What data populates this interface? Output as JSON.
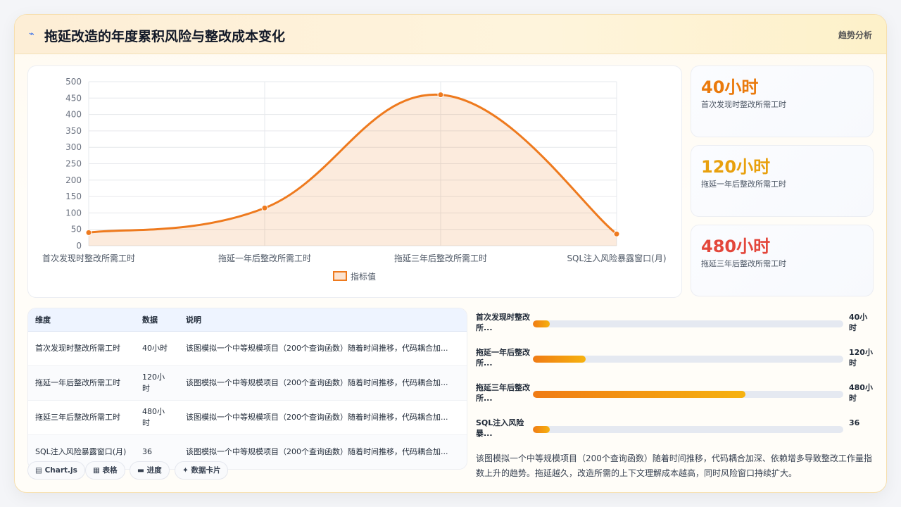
{
  "header": {
    "title": "拖延改造的年度累积风险与整改成本变化",
    "tag": "趋势分析"
  },
  "chart_data": {
    "type": "line",
    "categories": [
      "首次发现时整改所需工时",
      "拖延一年后整改所需工时",
      "拖延三年后整改所需工时",
      "SQL注入风险暴露窗口(月)"
    ],
    "series": [
      {
        "name": "指标值",
        "values": [
          40,
          115,
          460,
          36
        ]
      }
    ],
    "ylim": [
      0,
      500
    ],
    "yticks": [
      0,
      50,
      100,
      150,
      200,
      250,
      300,
      350,
      400,
      450,
      500
    ],
    "legend": "bottom",
    "grid": true,
    "fill": true,
    "color": "#ee7a1e"
  },
  "stats": [
    {
      "value": "40小时",
      "label": "首次发现时整改所需工时",
      "color": "#ea7a0c"
    },
    {
      "value": "120小时",
      "label": "拖延一年后整改所需工时",
      "color": "#e8a00d"
    },
    {
      "value": "480小时",
      "label": "拖延三年后整改所需工时",
      "color": "#e3473b"
    }
  ],
  "table": {
    "headers": [
      "维度",
      "数据",
      "说明"
    ],
    "rows": [
      [
        "首次发现时整改所需工时",
        "40小时",
        "该图模拟一个中等规模项目（200个查询函数）随着时间推移，代码耦合加..."
      ],
      [
        "拖延一年后整改所需工时",
        "120小时",
        "该图模拟一个中等规模项目（200个查询函数）随着时间推移，代码耦合加..."
      ],
      [
        "拖延三年后整改所需工时",
        "480小时",
        "该图模拟一个中等规模项目（200个查询函数）随着时间推移，代码耦合加..."
      ],
      [
        "SQL注入风险暴露窗口(月)",
        "36",
        "该图模拟一个中等规模项目（200个查询函数）随着时间推移，代码耦合加..."
      ]
    ]
  },
  "toolbar": [
    {
      "label": "▤ Chart.js",
      "icon": "chart-icon"
    },
    {
      "label": "▦ 表格",
      "icon": "table-icon"
    },
    {
      "label": "▬ 进度",
      "icon": "progress-icon"
    },
    {
      "label": "✦ 数据卡片",
      "icon": "card-icon"
    }
  ],
  "progress": [
    {
      "label": "首次发现时整改所...",
      "value": "40小时",
      "fraction": 0.055
    },
    {
      "label": "拖延一年后整改所...",
      "value": "120小时",
      "fraction": 0.17
    },
    {
      "label": "拖延三年后整改所...",
      "value": "480小时",
      "fraction": 0.685
    },
    {
      "label": "SQL注入风险暴...",
      "value": "36",
      "fraction": 0.055
    }
  ],
  "summary": "该图模拟一个中等规模项目（200个查询函数）随着时间推移，代码耦合加深、依赖增多导致整改工作量指数上升的趋势。拖延越久，改造所需的上下文理解成本越高，同时风险窗口持续扩大。"
}
